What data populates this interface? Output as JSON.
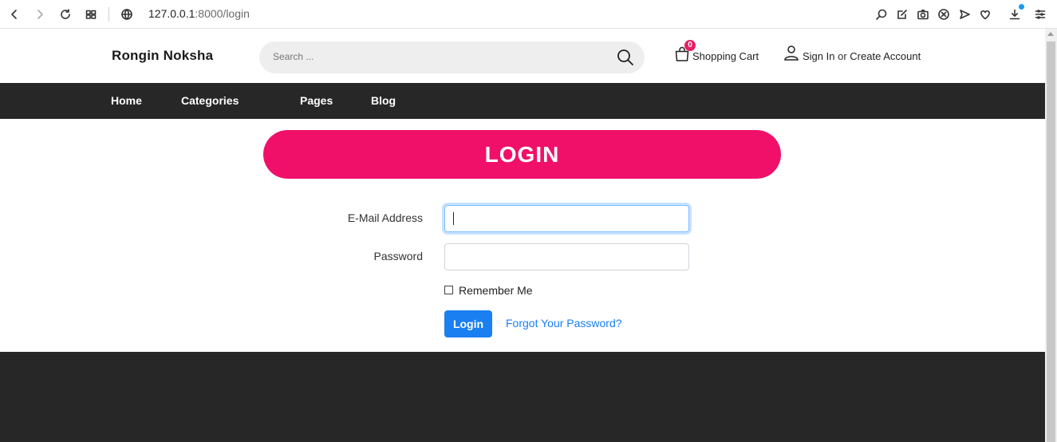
{
  "browser": {
    "url_host": "127.0.0.1",
    "url_rest": ":8000/login"
  },
  "header": {
    "brand": "Rongin Noksha",
    "search_placeholder": "Search ...",
    "cart_count": "0",
    "cart_label": "Shopping Cart",
    "sign_in": "Sign In",
    "or": "or",
    "create_account": "Create Account"
  },
  "nav": {
    "items": [
      {
        "label": "Home"
      },
      {
        "label": "Categories"
      },
      {
        "label": "Pages"
      },
      {
        "label": "Blog"
      }
    ]
  },
  "login": {
    "banner": "LOGIN",
    "email_label": "E-Mail Address",
    "email_value": "",
    "password_label": "Password",
    "password_value": "",
    "remember_label": "Remember Me",
    "remember_checked": false,
    "submit_label": "Login",
    "forgot_label": "Forgot Your Password?"
  },
  "colors": {
    "accent_pink": "#f0106a",
    "primary_blue": "#1a7ff0",
    "dark_bar": "#272727"
  }
}
